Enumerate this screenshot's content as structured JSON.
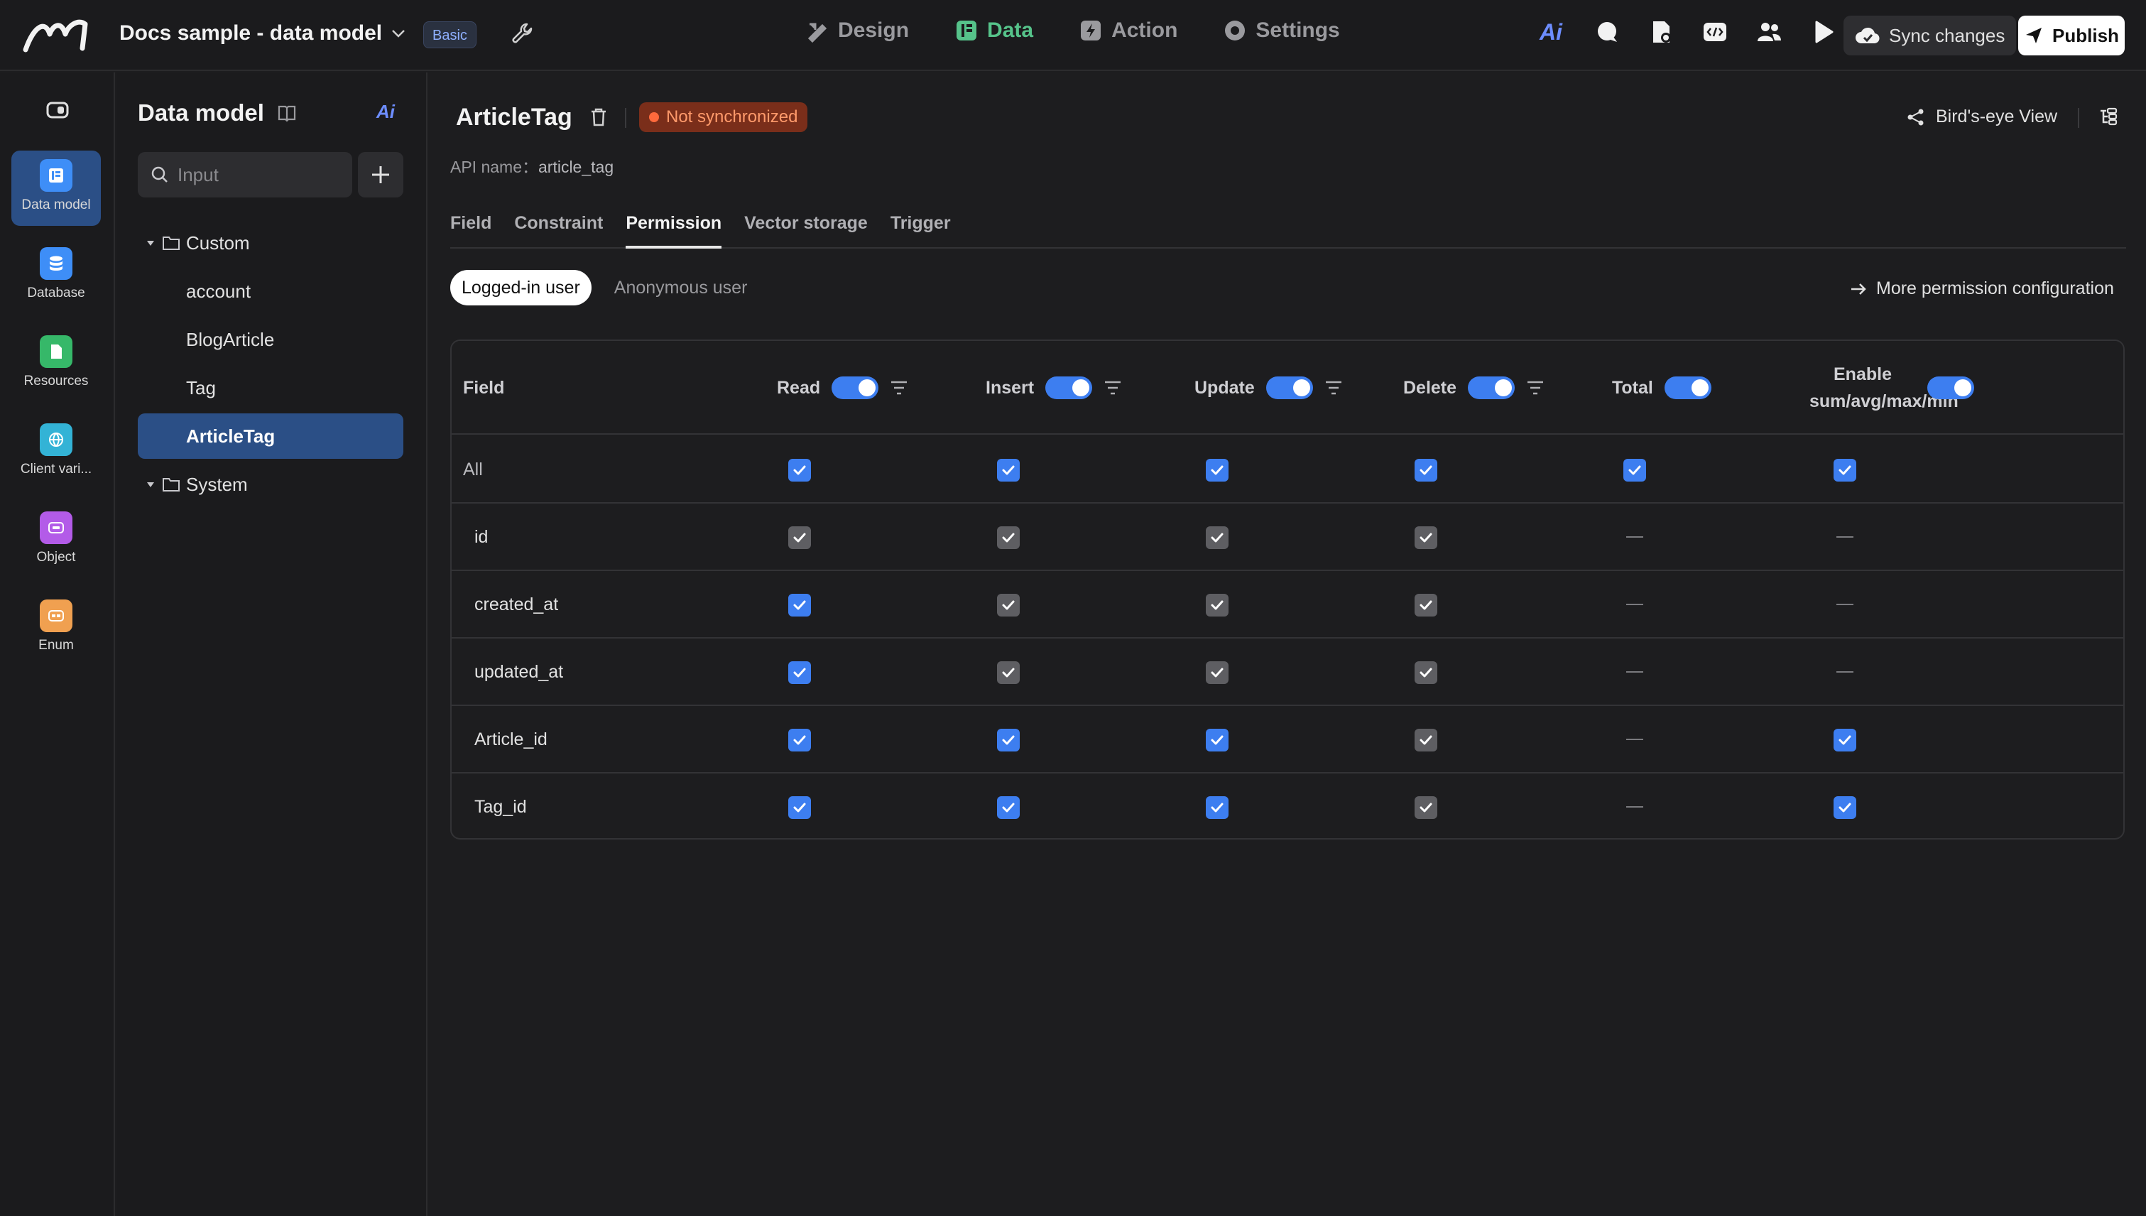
{
  "app": {
    "title": "Docs sample - data model",
    "badge": "Basic"
  },
  "nav": [
    {
      "label": "Design",
      "icon": "design-icon",
      "active": false
    },
    {
      "label": "Data",
      "icon": "data-icon",
      "active": true
    },
    {
      "label": "Action",
      "icon": "action-icon",
      "active": false
    },
    {
      "label": "Settings",
      "icon": "settings-icon",
      "active": false
    }
  ],
  "actions": {
    "sync": "Sync changes",
    "publish": "Publish",
    "ai": "Ai"
  },
  "rail": [
    {
      "label": "Data model",
      "color": "#3e8ef7",
      "active": true
    },
    {
      "label": "Database",
      "color": "#3e8ef7",
      "active": false
    },
    {
      "label": "Resources",
      "color": "#36b869",
      "active": false
    },
    {
      "label": "Client vari...",
      "color": "#33b3d6",
      "active": false
    },
    {
      "label": "Object",
      "color": "#b35be8",
      "active": false
    },
    {
      "label": "Enum",
      "color": "#f0a050",
      "active": false
    }
  ],
  "tree": {
    "title": "Data model",
    "ai": "Ai",
    "search_placeholder": "Input",
    "nodes": [
      {
        "label": "Custom",
        "type": "folder"
      },
      {
        "label": "account",
        "type": "item"
      },
      {
        "label": "BlogArticle",
        "type": "item"
      },
      {
        "label": "Tag",
        "type": "item"
      },
      {
        "label": "ArticleTag",
        "type": "item",
        "active": true
      },
      {
        "label": "System",
        "type": "folder"
      }
    ]
  },
  "entity": {
    "name": "ArticleTag",
    "status": "Not synchronized",
    "api_label": "API name：",
    "api_value": "article_tag",
    "birds_eye": "Bird's-eye View"
  },
  "tabs": [
    "Field",
    "Constraint",
    "Permission",
    "Vector storage",
    "Trigger"
  ],
  "active_tab": "Permission",
  "user_tabs": [
    "Logged-in user",
    "Anonymous user"
  ],
  "more_permission": "More permission configuration",
  "table": {
    "field_header": "Field",
    "columns": [
      {
        "label": "Read",
        "filter": true
      },
      {
        "label": "Insert",
        "filter": true
      },
      {
        "label": "Update",
        "filter": true
      },
      {
        "label": "Delete",
        "filter": true
      },
      {
        "label": "Total",
        "filter": false
      },
      {
        "label": "Enable sum/avg/max/min",
        "filter": false
      }
    ],
    "rows": [
      {
        "field": "All",
        "cells": [
          "blue",
          "blue",
          "blue",
          "blue",
          "blue",
          "blue"
        ]
      },
      {
        "field": "id",
        "cells": [
          "gray",
          "gray",
          "gray",
          "gray",
          "dash",
          "dash"
        ]
      },
      {
        "field": "created_at",
        "cells": [
          "blue",
          "gray",
          "gray",
          "gray",
          "dash",
          "dash"
        ]
      },
      {
        "field": "updated_at",
        "cells": [
          "blue",
          "gray",
          "gray",
          "gray",
          "dash",
          "dash"
        ]
      },
      {
        "field": "Article_id",
        "cells": [
          "blue",
          "blue",
          "blue",
          "gray",
          "dash",
          "blue"
        ]
      },
      {
        "field": "Tag_id",
        "cells": [
          "blue",
          "blue",
          "blue",
          "gray",
          "dash",
          "blue"
        ]
      }
    ]
  }
}
